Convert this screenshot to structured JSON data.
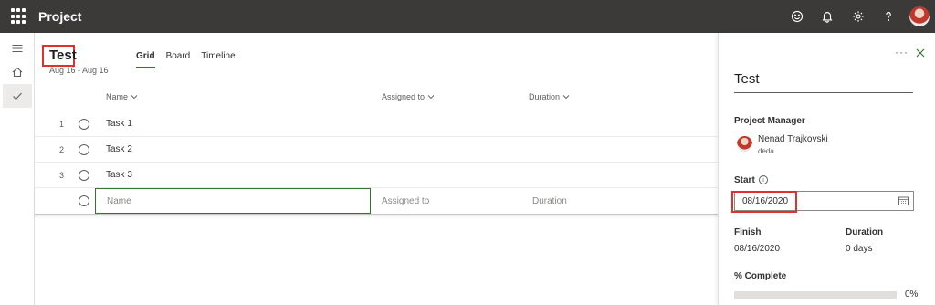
{
  "app": {
    "title": "Project"
  },
  "topbar": {
    "icons": [
      "smiley-icon",
      "bell-icon",
      "gear-icon",
      "help-icon",
      "user-avatar"
    ]
  },
  "rail": {
    "items": [
      "hamburger-icon",
      "home-icon",
      "checkmark-icon"
    ]
  },
  "plan": {
    "title": "Test",
    "date_range": "Aug 16 - Aug 16"
  },
  "tabs": [
    {
      "label": "Grid",
      "active": true
    },
    {
      "label": "Board",
      "active": false
    },
    {
      "label": "Timeline",
      "active": false
    }
  ],
  "grid": {
    "columns": [
      "Name",
      "Assigned to",
      "Duration"
    ],
    "rows": [
      {
        "num": "1",
        "name": "Task 1"
      },
      {
        "num": "2",
        "name": "Task 2"
      },
      {
        "num": "3",
        "name": "Task 3"
      }
    ],
    "new_row": {
      "name_placeholder": "Name",
      "assigned_placeholder": "Assigned to",
      "duration_placeholder": "Duration"
    }
  },
  "panel": {
    "title": "Test",
    "pm_label": "Project Manager",
    "pm_name": "Nenad Trajkovski",
    "pm_alias": "deda",
    "start_label": "Start",
    "start_value": "08/16/2020",
    "finish_label": "Finish",
    "finish_value": "08/16/2020",
    "duration_label": "Duration",
    "duration_value": "0 days",
    "complete_label": "% Complete",
    "complete_value": "0%",
    "complete_fraction": 0
  },
  "colors": {
    "accent": "#31752f",
    "topbar": "#3b3a39",
    "highlight": "#e0312f"
  }
}
